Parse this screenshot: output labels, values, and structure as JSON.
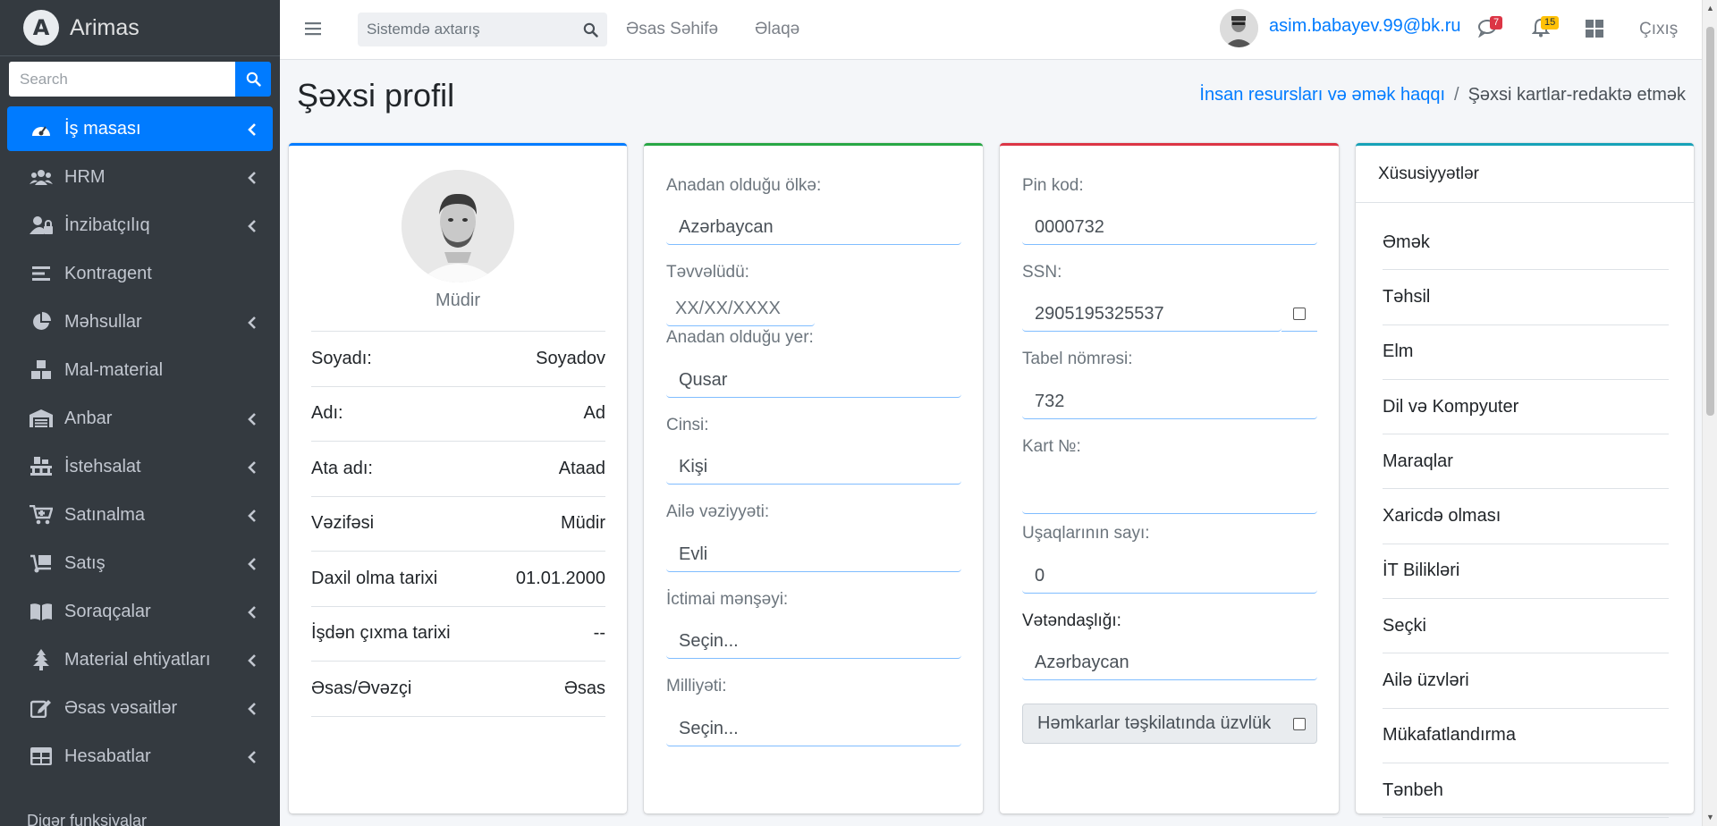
{
  "brand": {
    "name": "Arimas",
    "logo_letter": "A"
  },
  "sidebar": {
    "search_placeholder": "Search",
    "items": [
      {
        "label": "İş masası",
        "icon": "tachometer-icon",
        "active": true,
        "has_chevron": true
      },
      {
        "label": "HRM",
        "icon": "users-icon",
        "has_chevron": true
      },
      {
        "label": "İnzibatçılıq",
        "icon": "user-lock-icon",
        "has_chevron": true
      },
      {
        "label": "Kontragent",
        "icon": "list-icon",
        "has_chevron": false
      },
      {
        "label": "Məhsullar",
        "icon": "pie-chart-icon",
        "has_chevron": true
      },
      {
        "label": "Mal-material",
        "icon": "boxes-icon",
        "has_chevron": false
      },
      {
        "label": "Anbar",
        "icon": "warehouse-icon",
        "has_chevron": true
      },
      {
        "label": "İstehsalat",
        "icon": "pallet-icon",
        "has_chevron": true
      },
      {
        "label": "Satınalma",
        "icon": "cart-icon",
        "has_chevron": true
      },
      {
        "label": "Satış",
        "icon": "dolly-icon",
        "has_chevron": true
      },
      {
        "label": "Soraqçalar",
        "icon": "book-icon",
        "has_chevron": true
      },
      {
        "label": "Material ehtiyatları",
        "icon": "tree-icon",
        "has_chevron": true
      },
      {
        "label": "Əsas vəsaitlər",
        "icon": "edit-icon",
        "has_chevron": true
      },
      {
        "label": "Hesabatlar",
        "icon": "table-icon",
        "has_chevron": true
      }
    ],
    "footer": "Digər funksiyalar"
  },
  "topbar": {
    "search_placeholder": "Sistemdə axtarış",
    "links": [
      "Əsas Səhifə",
      "Əlaqə"
    ],
    "user_email": "asim.babayev.99@bk.ru",
    "messages_count": "7",
    "notifications_count": "15",
    "logout": "Çıxış"
  },
  "page": {
    "title": "Şəxsi profil",
    "breadcrumb": [
      "İnsan resursları və əmək haqqı",
      "Şəxsi kartlar-redaktə etmək"
    ]
  },
  "profile": {
    "role": "Müdir",
    "rows": [
      {
        "label": "Soyadı:",
        "value": "Soyadov"
      },
      {
        "label": "Adı:",
        "value": "Ad"
      },
      {
        "label": "Ata adı:",
        "value": "Ataad"
      },
      {
        "label": "Vəzifəsi",
        "value": "Müdir"
      },
      {
        "label": "Daxil olma tarixi",
        "value": "01.01.2000"
      },
      {
        "label": "İşdən çıxma tarixi",
        "value": "--"
      },
      {
        "label": "Əsas/Əvəzçi",
        "value": "Əsas"
      }
    ]
  },
  "personal": {
    "country_label": "Anadan olduğu ölkə:",
    "country_value": "Azərbaycan",
    "birthdate_label": "Təvvəlüdü:",
    "birthdate_placeholder": "XX/XX/XXXX",
    "birthplace_label": "Anadan olduğu yer:",
    "birthplace_value": "Qusar",
    "gender_label": "Cinsi:",
    "gender_value": "Kişi",
    "marital_label": "Ailə vəziyyəti:",
    "marital_value": "Evli",
    "social_label": "İctimai mənşəyi:",
    "social_value": "Seçin...",
    "nationality_label": "Milliyəti:",
    "nationality_value": "Seçin..."
  },
  "ids": {
    "pin_label": "Pin kod:",
    "pin_value": "0000732",
    "ssn_label": "SSN:",
    "ssn_value": "2905195325537",
    "tabel_label": "Tabel nömrəsi:",
    "tabel_value": "732",
    "card_label": "Kart №:",
    "card_value": "",
    "children_label": "Uşaqlarının sayı:",
    "children_value": "0",
    "citizenship_label": "Vətəndaşlığı:",
    "citizenship_value": "Azərbaycan",
    "union_label": "Həmkarlar təşkilatında üzvlük"
  },
  "features": {
    "header": "Xüsusiyyətlər",
    "items": [
      "Əmək",
      "Təhsil",
      "Elm",
      "Dil və Kompyuter",
      "Maraqlar",
      "Xaricdə olması",
      "İT Bilikləri",
      "Seçki",
      "Ailə üzvləri",
      "Mükafatlandırma",
      "Tənbeh"
    ]
  },
  "colors": {
    "primary": "#007bff",
    "success": "#28a745",
    "danger": "#dc3545",
    "info": "#17a2b8",
    "sidebar": "#343a40"
  }
}
